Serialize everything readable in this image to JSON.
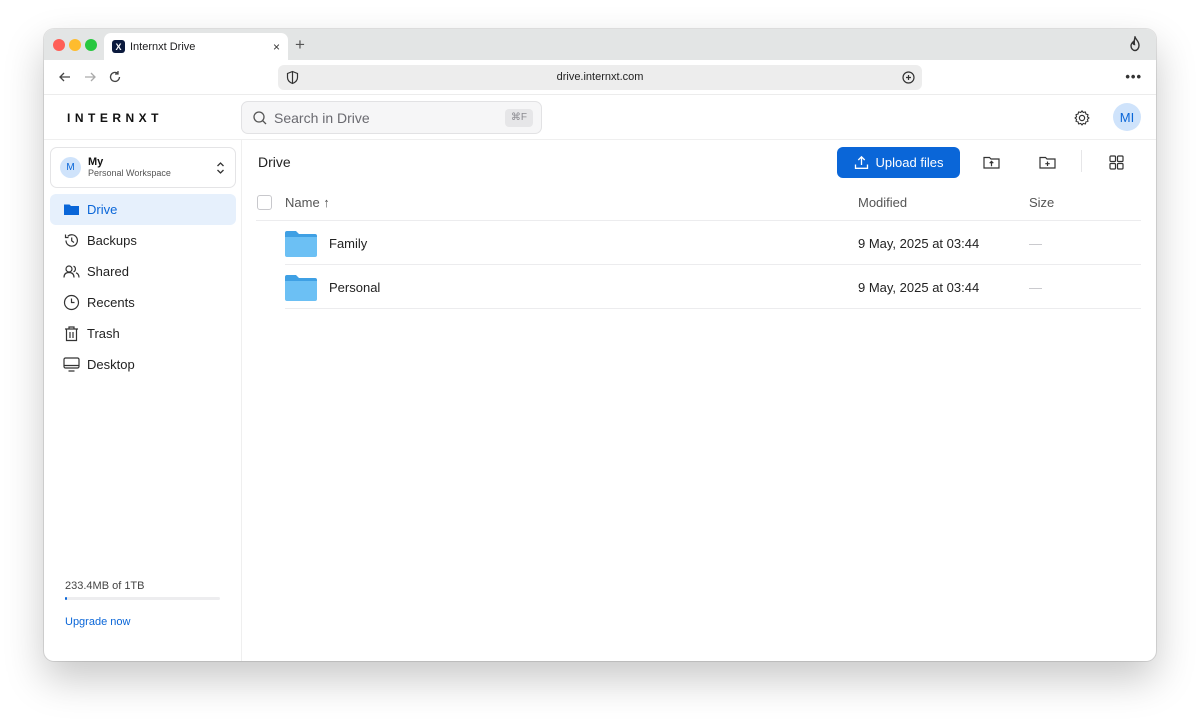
{
  "browser": {
    "tab_title": "Internxt Drive",
    "tab_favicon_letter": "X",
    "tab_close": "×",
    "new_tab": "+",
    "url": "drive.internxt.com",
    "menu": "•••"
  },
  "header": {
    "logo": "INTERNXT",
    "search_placeholder": "Search in Drive",
    "search_shortcut": "⌘F",
    "avatar_initials": "MI"
  },
  "workspace": {
    "avatar_letter": "M",
    "name": "My",
    "subtitle": "Personal Workspace"
  },
  "sidebar": {
    "items": [
      {
        "label": "Drive",
        "icon": "folder-icon",
        "active": true
      },
      {
        "label": "Backups",
        "icon": "history-icon",
        "active": false
      },
      {
        "label": "Shared",
        "icon": "users-icon",
        "active": false
      },
      {
        "label": "Recents",
        "icon": "clock-icon",
        "active": false
      },
      {
        "label": "Trash",
        "icon": "trash-icon",
        "active": false
      },
      {
        "label": "Desktop",
        "icon": "desktop-icon",
        "active": false
      }
    ],
    "storage_text": "233.4MB of 1TB",
    "storage_used_fraction": 0.0002,
    "upgrade_label": "Upgrade now"
  },
  "main": {
    "breadcrumb": "Drive",
    "upload_label": "Upload files",
    "columns": {
      "name": "Name ↑",
      "modified": "Modified",
      "size": "Size"
    },
    "rows": [
      {
        "name": "Family",
        "modified": "9 May, 2025 at 03:44",
        "size": "—"
      },
      {
        "name": "Personal",
        "modified": "9 May, 2025 at 03:44",
        "size": "—"
      }
    ]
  },
  "colors": {
    "accent": "#0a66d8",
    "active_bg": "#e6f0fc",
    "folder": "#5eb4f0"
  }
}
